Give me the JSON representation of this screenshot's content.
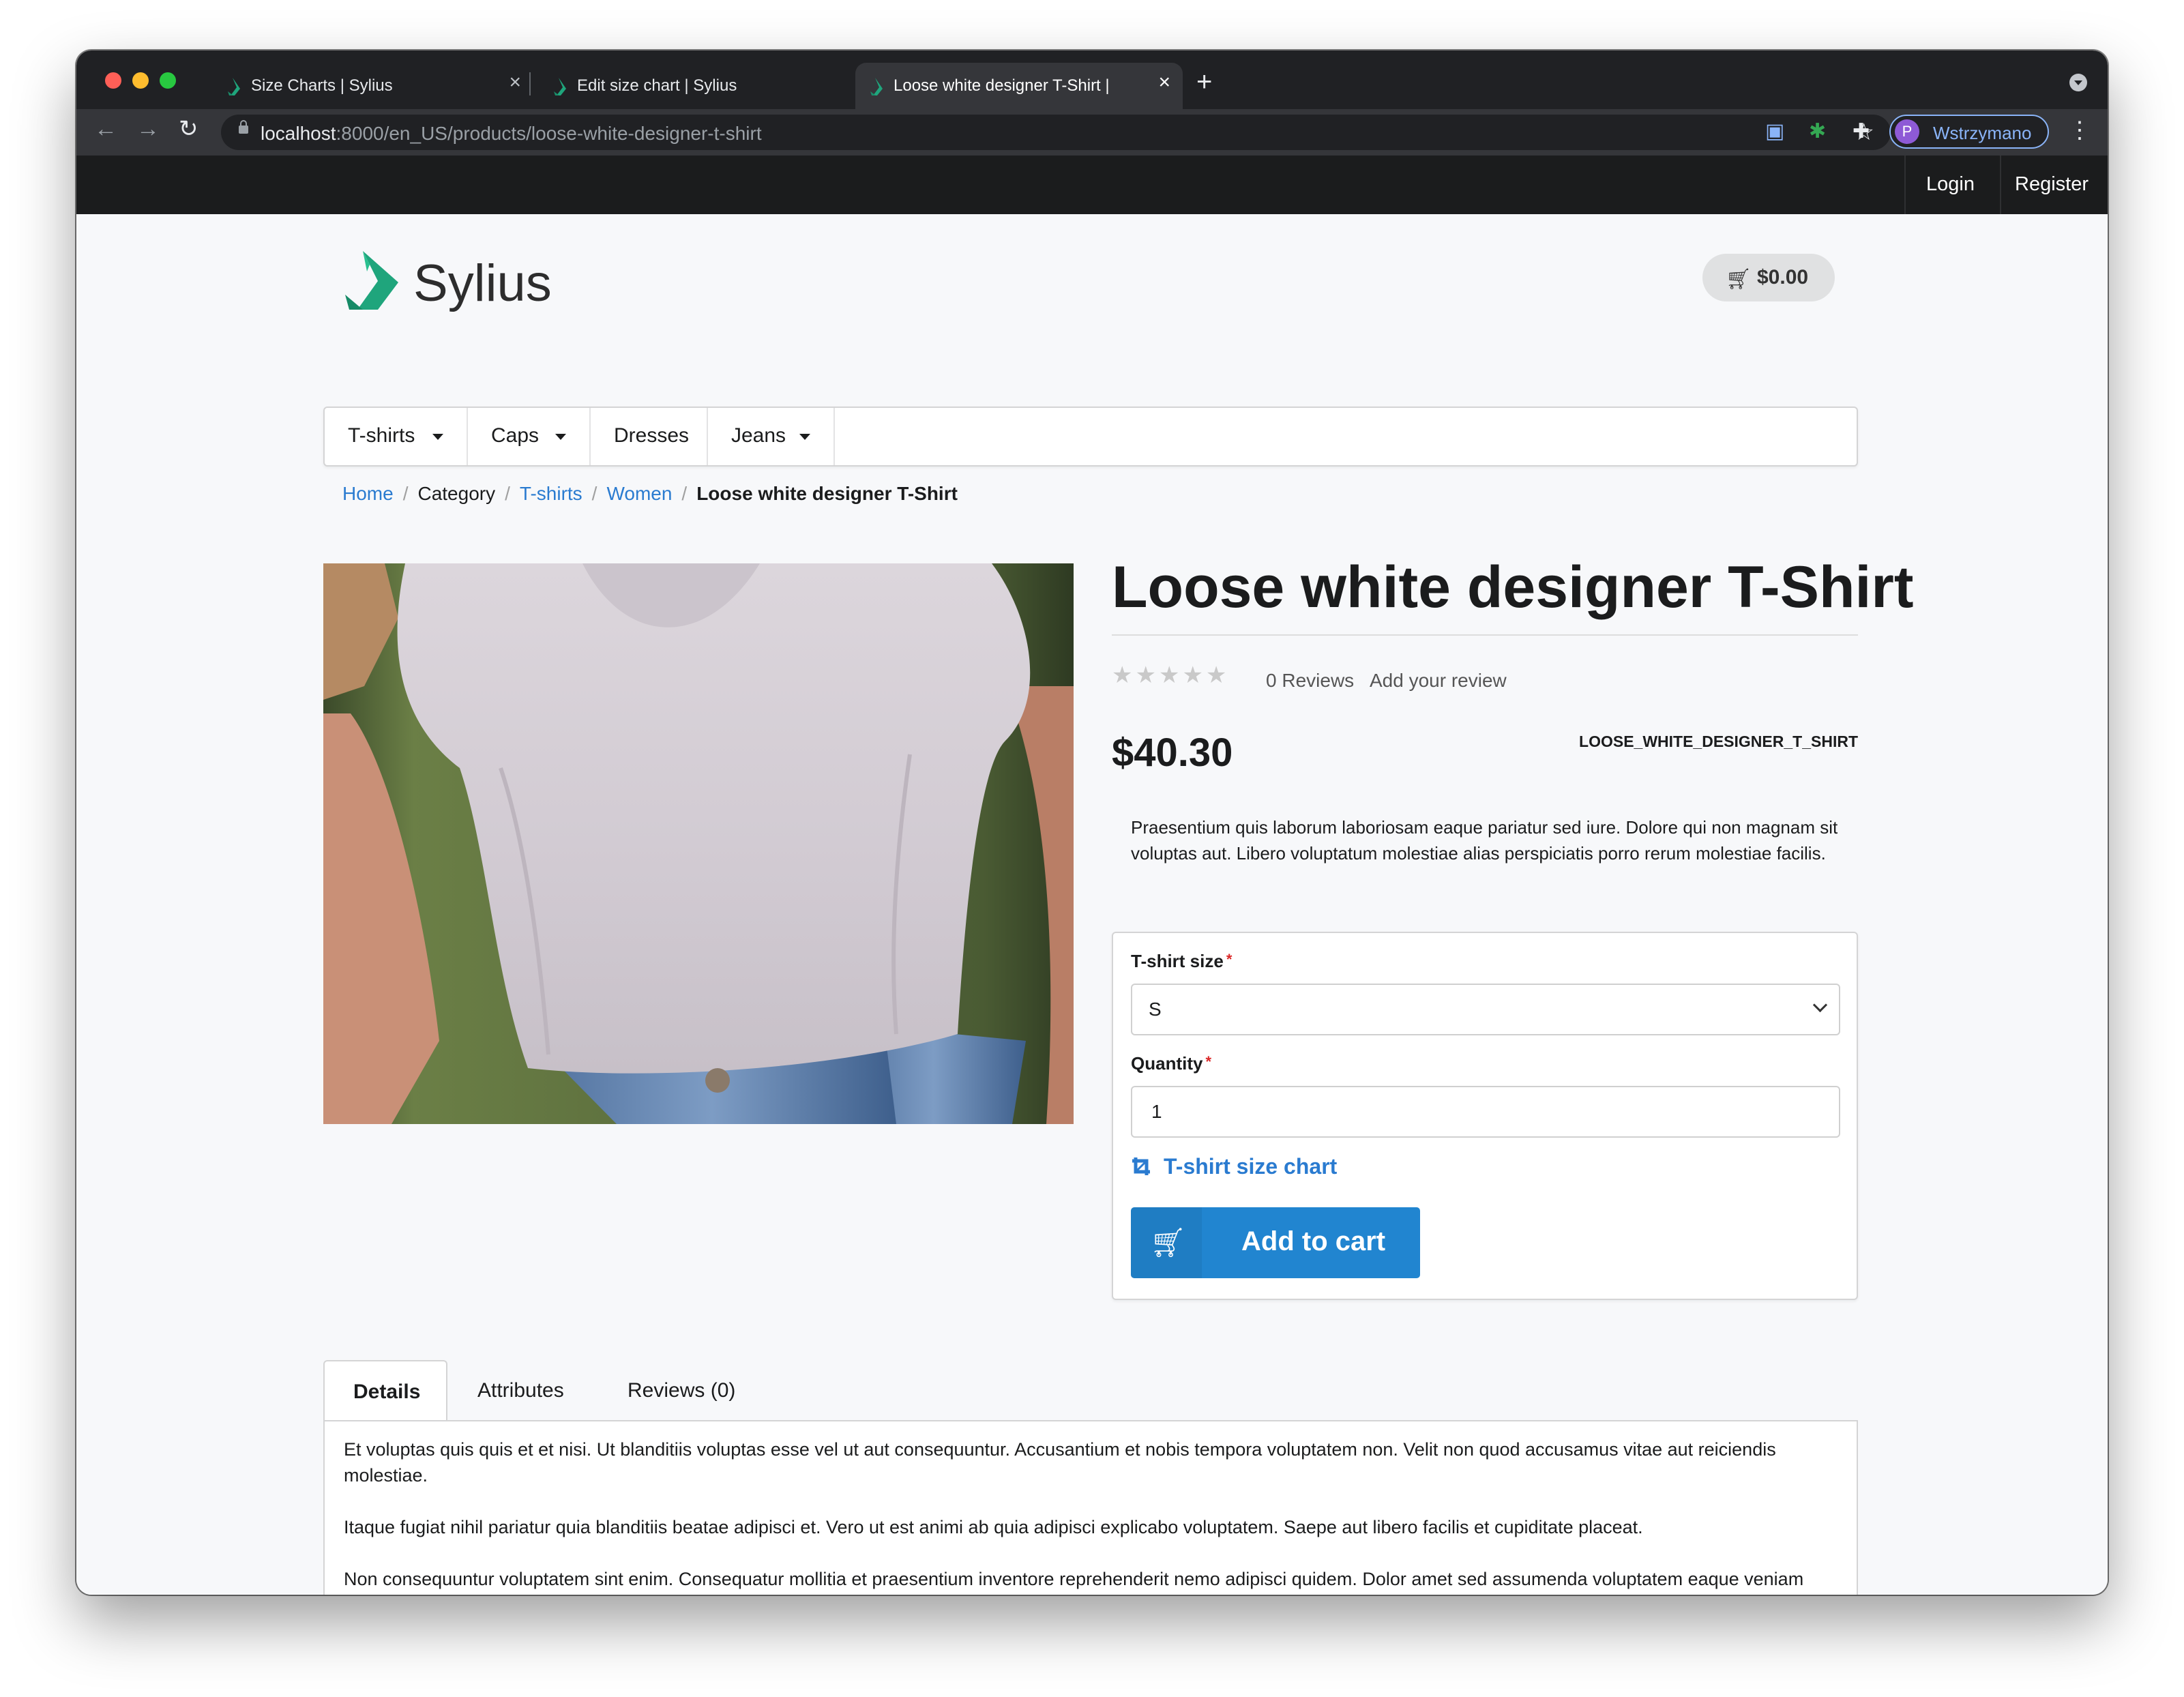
{
  "browser": {
    "tabs": [
      {
        "title": "Size Charts | Sylius",
        "active": false
      },
      {
        "title": "Edit size chart | Sylius",
        "active": false
      },
      {
        "title": "Loose white designer T-Shirt |",
        "active": true
      }
    ],
    "url_host": "localhost",
    "url_path": ":8000/en_US/products/loose-white-designer-t-shirt",
    "profile_initial": "P",
    "profile_name": "Wstrzymano"
  },
  "topbar": {
    "login": "Login",
    "register": "Register"
  },
  "header": {
    "brand": "Sylius",
    "cart_total": "$0.00"
  },
  "menu": {
    "items": [
      {
        "label": "T-shirts",
        "has_dropdown": true
      },
      {
        "label": "Caps",
        "has_dropdown": true
      },
      {
        "label": "Dresses",
        "has_dropdown": false
      },
      {
        "label": "Jeans",
        "has_dropdown": true
      }
    ]
  },
  "breadcrumb": {
    "home": "Home",
    "category": "Category",
    "tshirts": "T-shirts",
    "women": "Women",
    "current": "Loose white designer T-Shirt",
    "separator": "/"
  },
  "product": {
    "title": "Loose white designer T-Shirt",
    "rating_stars": "★★★★★",
    "rating_value": 0,
    "reviews_count": "0 Reviews",
    "add_review": "Add your review",
    "price": "$40.30",
    "code": "LOOSE_WHITE_DESIGNER_T_SHIRT",
    "short_description": "Praesentium quis laborum laboriosam eaque pariatur sed iure. Dolore qui non magnam sit voluptas aut. Libero voluptatum molestiae alias perspiciatis porro rerum molestiae facilis."
  },
  "cart_form": {
    "size_label": "T-shirt size",
    "size_value": "S",
    "quantity_label": "Quantity",
    "quantity_value": "1",
    "required_mark": "*",
    "size_chart_link": "T-shirt size chart",
    "add_to_cart": "Add to cart"
  },
  "tabs": {
    "details": "Details",
    "attributes": "Attributes",
    "reviews": "Reviews (0)",
    "details_paragraphs": [
      "Et voluptas quis quis et et nisi. Ut blanditiis voluptas esse vel ut aut consequuntur. Accusantium et nobis tempora voluptatem non. Velit non quod accusamus vitae aut reiciendis molestiae.",
      "Itaque fugiat nihil pariatur quia blanditiis beatae adipisci et. Vero ut est animi ab quia adipisci explicabo voluptatem. Saepe aut libero facilis et cupiditate placeat.",
      "Non consequuntur voluptatem sint enim. Consequatur mollitia et praesentium inventore reprehenderit nemo adipisci quidem. Dolor amet sed assumenda voluptatem eaque veniam alias. Eos et et est dignissimos autem ut."
    ]
  },
  "colors": {
    "accent": "#2185d0",
    "link": "#2a7bd0",
    "brand_green": "#1fa57c"
  }
}
